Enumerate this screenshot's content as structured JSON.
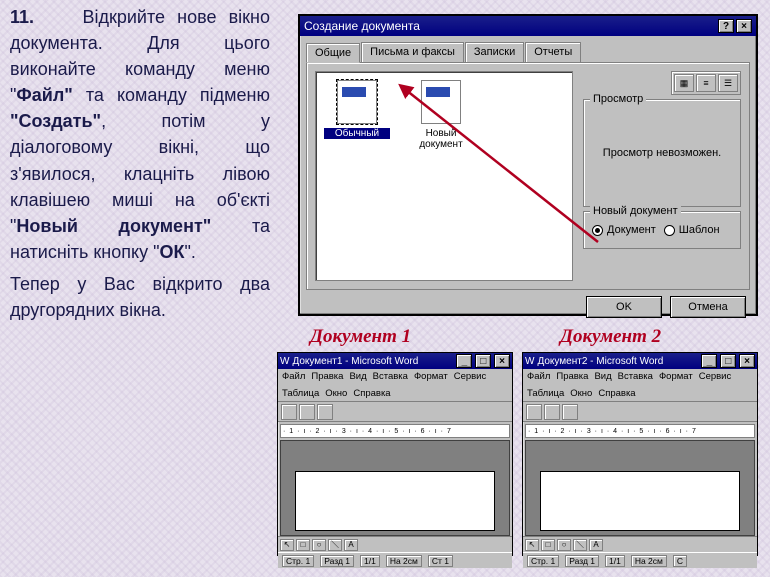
{
  "instruction": {
    "number": "11.",
    "para1_pre": "Відкрийте нове вікно документа. Для цього виконайте команду меню \"",
    "bold_file": "Файл\"",
    "para1_mid": " та команду підменю ",
    "bold_create": "\"Создать\"",
    "para1_mid2": ", потім у діалоговому вікні, що з'явилося, клацніть лівою клавішею миші на об'єкті \"",
    "bold_newdoc": "Новый документ\"",
    "para1_mid3": " та натисніть кнопку \"",
    "bold_ok": "ОК",
    "para1_end": "\".",
    "para2": "Тепер у Вас відкрито два другорядних вікна."
  },
  "dialog": {
    "title": "Создание документа",
    "help": "?",
    "close": "×",
    "tabs": [
      "Общие",
      "Письма и факсы",
      "Записки",
      "Отчеты"
    ],
    "templates": [
      {
        "label": "Обычный"
      },
      {
        "label": "Новый документ"
      }
    ],
    "preview_legend": "Просмотр",
    "preview_text": "Просмотр невозможен.",
    "newdoc_legend": "Новый документ",
    "radio_doc": "Документ",
    "radio_tpl": "Шаблон",
    "ok": "OK",
    "cancel": "Отмена"
  },
  "labels": {
    "doc1": "Документ 1",
    "doc2": "Документ 2"
  },
  "word": {
    "title1": "Документ1 - Microsoft Word",
    "title2": "Документ2 - Microsoft Word",
    "menu": [
      "Файл",
      "Правка",
      "Вид",
      "Вставка",
      "Формат",
      "Сервис",
      "Таблица",
      "Окно",
      "Справка"
    ],
    "ruler": "· 1 · ı · 2 · ı · 3 · ı · 4 · ı · 5 · ı · 6 · ı · 7",
    "status": {
      "page": "Стр. 1",
      "sec": "Разд 1",
      "pg": "1/1",
      "at": "На 2см",
      "ln": "Ст 1",
      "col": "С"
    }
  }
}
